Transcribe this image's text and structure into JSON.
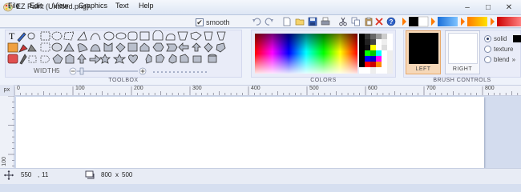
{
  "window": {
    "title": "EZ Paint (Untitled.png)",
    "app_icon": "palette-icon",
    "controls": {
      "minimize": "–",
      "maximize": "□",
      "close": "✕"
    }
  },
  "menu": [
    "File",
    "Edit",
    "View",
    "Graphics",
    "Text",
    "Help"
  ],
  "smooth": {
    "label": "smooth",
    "checked": true,
    "check_glyph": "✔"
  },
  "toolbar_icons": [
    "undo-icon",
    "redo-icon",
    "new-file-icon",
    "open-file-icon",
    "save-icon",
    "print-icon",
    "cut-icon",
    "copy-icon",
    "paste-icon",
    "delete-icon",
    "help-icon"
  ],
  "toolbox": {
    "caption": "TOOLBOX",
    "width_label": "WIDTH",
    "width_value": "5",
    "tools": [
      "text-tool-icon",
      "pen-tool-icon",
      "select-rect-icon",
      "select-freeform-icon",
      "rectangle-icon",
      "ellipse-icon",
      "polygon-icon",
      "star-icon",
      "arrow-icon",
      "heart-icon",
      "cube-icon",
      "cylinder-icon"
    ]
  },
  "colors": {
    "caption": "COLORS",
    "palette": [
      "#000000",
      "#ffffff",
      "#ff0000",
      "#00ff00",
      "#0000ff",
      "#ffff00",
      "#00ffff",
      "#ff00ff",
      "#808080",
      "#c0c0c0"
    ]
  },
  "brush": {
    "caption": "BRUSH CONTROLS",
    "left_label": "LEFT",
    "right_label": "RIGHT",
    "left_color": "#000000",
    "right_color": "#ffffff",
    "modes": [
      {
        "label": "solid",
        "selected": true
      },
      {
        "label": "texture",
        "selected": false
      },
      {
        "label": "blend",
        "selected": false
      }
    ],
    "blend_suffix": "»"
  },
  "ruler": {
    "unit": "px",
    "top_labels": [
      "0",
      "100",
      "200",
      "300",
      "400",
      "500",
      "600",
      "700",
      "800"
    ],
    "left_label": "100"
  },
  "status": {
    "cursor_icon": "crosshair-icon",
    "cursor_x": "550",
    "cursor_sep": ",",
    "cursor_y": "11",
    "size_icon": "canvas-size-icon",
    "size_w": "800",
    "size_x": "x",
    "size_h": "500"
  }
}
